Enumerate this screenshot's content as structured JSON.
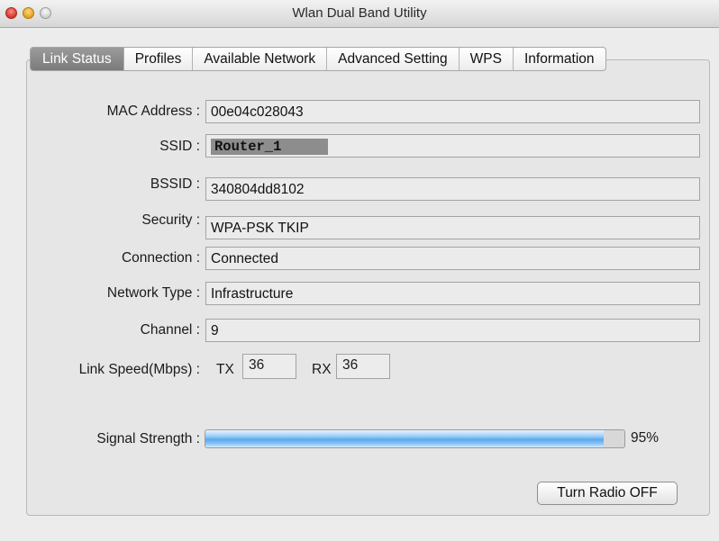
{
  "window": {
    "title": "Wlan Dual Band Utility"
  },
  "tabs": [
    {
      "label": "Link Status",
      "active": true
    },
    {
      "label": "Profiles",
      "active": false
    },
    {
      "label": "Available Network",
      "active": false
    },
    {
      "label": "Advanced Setting",
      "active": false
    },
    {
      "label": "WPS",
      "active": false
    },
    {
      "label": "Information",
      "active": false
    }
  ],
  "fields": {
    "mac_address": {
      "label": "MAC Address :",
      "value": "00e04c028043"
    },
    "ssid": {
      "label": "SSID :",
      "value": "Router_1"
    },
    "bssid": {
      "label": "BSSID :",
      "value": "340804dd8102"
    },
    "security": {
      "label": "Security :",
      "value": "WPA-PSK TKIP"
    },
    "connection": {
      "label": "Connection :",
      "value": "Connected"
    },
    "network_type": {
      "label": "Network Type :",
      "value": "Infrastructure"
    },
    "channel": {
      "label": "Channel :",
      "value": "9"
    }
  },
  "link_speed": {
    "label": "Link Speed(Mbps) :",
    "tx_label": "TX",
    "tx_value": "36",
    "rx_label": "RX",
    "rx_value": "36"
  },
  "signal": {
    "label": "Signal Strength :",
    "percent_text": "95%",
    "level": 0.95
  },
  "buttons": {
    "turn_radio_off": "Turn Radio OFF"
  },
  "colors": {
    "active_tab": "#8a8a8a",
    "progress_fill": "#5aa8ee"
  }
}
